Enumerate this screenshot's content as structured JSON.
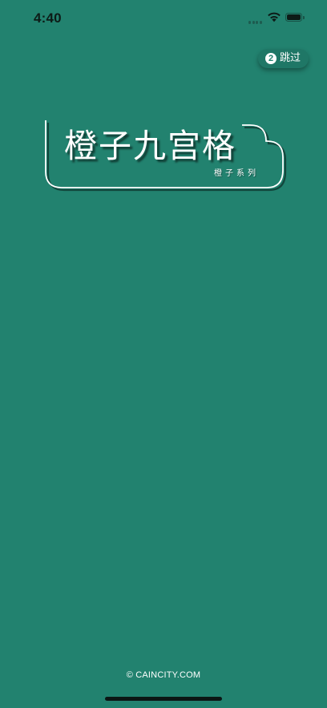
{
  "status_bar": {
    "time": "4:40"
  },
  "skip": {
    "countdown": "2",
    "label": "跳过"
  },
  "logo": {
    "title": "橙子九宫格",
    "subtitle": "橙子系列"
  },
  "footer": {
    "copyright": "© CAINCITY.COM"
  },
  "colors": {
    "background": "#22826f",
    "skip_button": "#1f7766",
    "text": "#ffffff",
    "status_text": "#0d1b17"
  },
  "icons": {
    "signal": "cellular-signal-icon",
    "wifi": "wifi-icon",
    "battery": "battery-icon"
  }
}
